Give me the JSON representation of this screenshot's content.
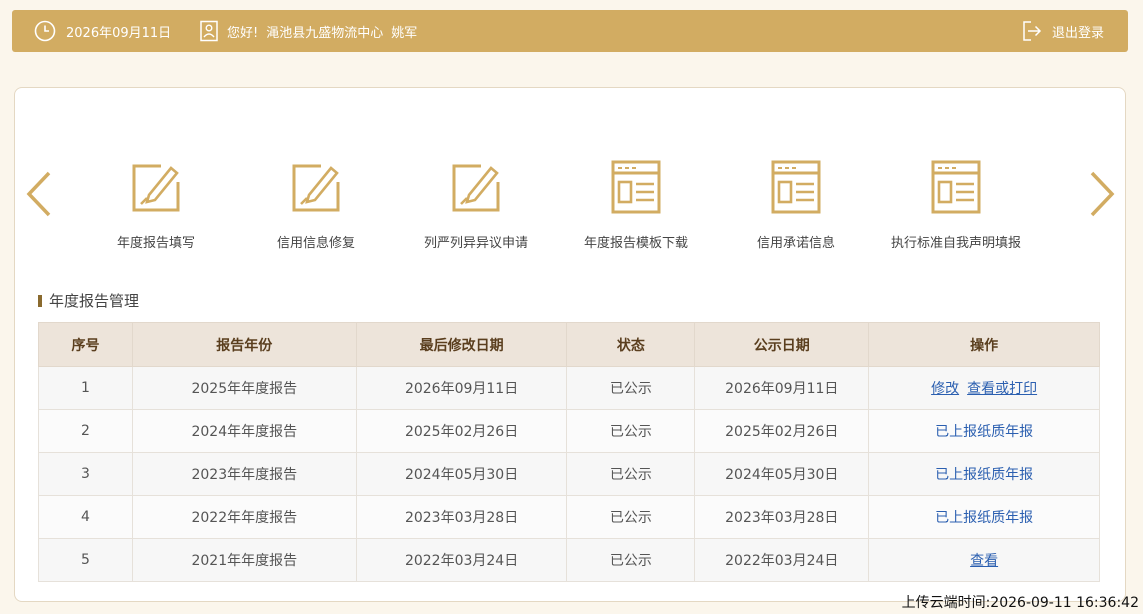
{
  "topbar": {
    "date": "2026年09月11日",
    "greeting": "您好!",
    "company": "渑池县九盛物流中心",
    "user": "姚军",
    "logout": "退出登录"
  },
  "quick_actions": [
    {
      "label": "年度报告填写",
      "icon": "edit-form-icon"
    },
    {
      "label": "信用信息修复",
      "icon": "edit-form-icon"
    },
    {
      "label": "列严列异异议申请",
      "icon": "edit-form-icon"
    },
    {
      "label": "年度报告模板下载",
      "icon": "document-template-icon"
    },
    {
      "label": "信用承诺信息",
      "icon": "document-template-icon"
    },
    {
      "label": "执行标准自我声明填报",
      "icon": "document-template-icon"
    }
  ],
  "section": {
    "title": "年度报告管理"
  },
  "table": {
    "headers": [
      "序号",
      "报告年份",
      "最后修改日期",
      "状态",
      "公示日期",
      "操作"
    ],
    "rows": [
      {
        "no": "1",
        "year": "2025年年度报告",
        "modified": "2026年09月11日",
        "status": "已公示",
        "publish": "2026年09月11日",
        "action1": "修改",
        "action2": "查看或打印"
      },
      {
        "no": "2",
        "year": "2024年年度报告",
        "modified": "2025年02月26日",
        "status": "已公示",
        "publish": "2025年02月26日",
        "action1": "已上报纸质年报"
      },
      {
        "no": "3",
        "year": "2023年年度报告",
        "modified": "2024年05月30日",
        "status": "已公示",
        "publish": "2024年05月30日",
        "action1": "已上报纸质年报"
      },
      {
        "no": "4",
        "year": "2022年年度报告",
        "modified": "2023年03月28日",
        "status": "已公示",
        "publish": "2023年03月28日",
        "action1": "已上报纸质年报"
      },
      {
        "no": "5",
        "year": "2021年年度报告",
        "modified": "2022年03月24日",
        "status": "已公示",
        "publish": "2022年03月24日",
        "action1": "查看"
      }
    ]
  },
  "footer": {
    "upload_time": "上传云端时间:2026-09-11 16:36:42"
  },
  "colors": {
    "accent": "#d2ac62",
    "icon": "#d2ac62",
    "link": "#2b5fb0",
    "header_bg": "#ede4da"
  }
}
